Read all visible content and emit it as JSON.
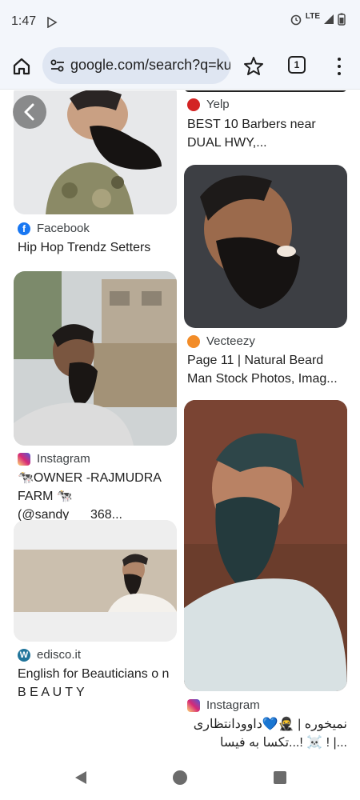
{
  "status": {
    "time": "1:47",
    "network": "LTE"
  },
  "browser": {
    "url": "google.com/search?q=ku",
    "tab_count": "1"
  },
  "results": [
    {
      "source": "Facebook",
      "title": "Hip Hop Trendz Setters",
      "source_color": "#1877f2"
    },
    {
      "source": "Instagram",
      "title": "🐄OWNER -RAJMUDRA FARM 🐄 (@sandy___368...",
      "source_color": "#d62976"
    },
    {
      "source": "edisco.it",
      "title": "English for Beauticians o n B E A U T Y",
      "source_color": "#21759b"
    },
    {
      "source": "Yelp",
      "title": "BEST 10 Barbers near DUAL HWY,...",
      "source_color": "#d32323"
    },
    {
      "source": "Vecteezy",
      "title": "Page 11 | Natural Beard Man Stock Photos, Imag...",
      "source_color": "#f28c28"
    },
    {
      "source": "Instagram",
      "title": "نمیخوره | 🥷💙داوودانتظاری ...| ! ☠️ !...تکسا به فیسا",
      "source_color": "#d62976"
    }
  ]
}
